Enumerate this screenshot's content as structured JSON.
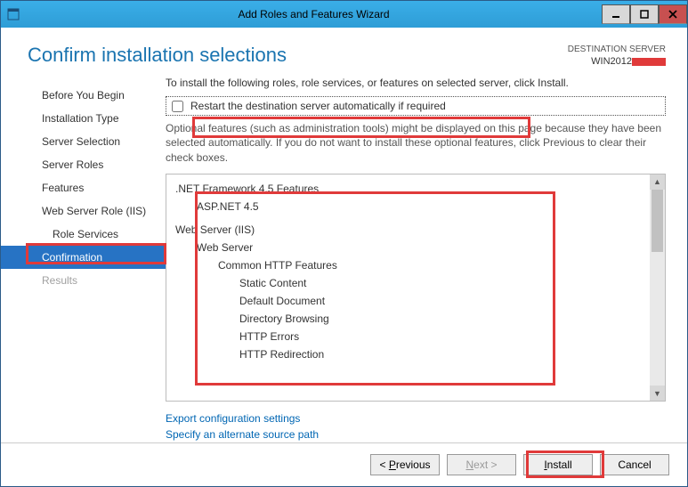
{
  "window": {
    "title": "Add Roles and Features Wizard"
  },
  "header": {
    "page_title": "Confirm installation selections",
    "dest_label": "DESTINATION SERVER",
    "dest_server": "WIN2012"
  },
  "nav": {
    "items": [
      {
        "label": "Before You Begin"
      },
      {
        "label": "Installation Type"
      },
      {
        "label": "Server Selection"
      },
      {
        "label": "Server Roles"
      },
      {
        "label": "Features"
      },
      {
        "label": "Web Server Role (IIS)"
      },
      {
        "label": "Role Services",
        "indent": true
      },
      {
        "label": "Confirmation",
        "active": true
      },
      {
        "label": "Results",
        "disabled": true
      }
    ]
  },
  "content": {
    "intro": "To install the following roles, role services, or features on selected server, click Install.",
    "restart_label": "Restart the destination server automatically if required",
    "note": "Optional features (such as administration tools) might be displayed on this page because they have been selected automatically. If you do not want to install these optional features, click Previous to clear their check boxes.",
    "list": [
      {
        "text": ".NET Framework 4.5 Features",
        "level": 0
      },
      {
        "text": "ASP.NET 4.5",
        "level": 1
      },
      {
        "text": "Web Server (IIS)",
        "level": 0
      },
      {
        "text": "Web Server",
        "level": 1
      },
      {
        "text": "Common HTTP Features",
        "level": 2
      },
      {
        "text": "Static Content",
        "level": 3
      },
      {
        "text": "Default Document",
        "level": 3
      },
      {
        "text": "Directory Browsing",
        "level": 3
      },
      {
        "text": "HTTP Errors",
        "level": 3
      },
      {
        "text": "HTTP Redirection",
        "level": 3
      }
    ],
    "links": {
      "export": "Export configuration settings",
      "altpath": "Specify an alternate source path"
    }
  },
  "footer": {
    "previous": "< Previous",
    "next": "Next >",
    "install": "Install",
    "cancel": "Cancel"
  }
}
